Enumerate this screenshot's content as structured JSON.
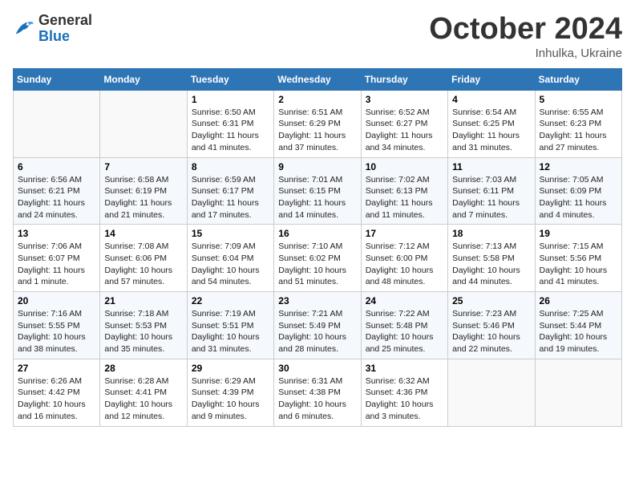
{
  "logo": {
    "general": "General",
    "blue": "Blue"
  },
  "header": {
    "month": "October 2024",
    "location": "Inhulka, Ukraine"
  },
  "weekdays": [
    "Sunday",
    "Monday",
    "Tuesday",
    "Wednesday",
    "Thursday",
    "Friday",
    "Saturday"
  ],
  "weeks": [
    [
      {
        "day": "",
        "content": ""
      },
      {
        "day": "",
        "content": ""
      },
      {
        "day": "1",
        "content": "Sunrise: 6:50 AM\nSunset: 6:31 PM\nDaylight: 11 hours and 41 minutes."
      },
      {
        "day": "2",
        "content": "Sunrise: 6:51 AM\nSunset: 6:29 PM\nDaylight: 11 hours and 37 minutes."
      },
      {
        "day": "3",
        "content": "Sunrise: 6:52 AM\nSunset: 6:27 PM\nDaylight: 11 hours and 34 minutes."
      },
      {
        "day": "4",
        "content": "Sunrise: 6:54 AM\nSunset: 6:25 PM\nDaylight: 11 hours and 31 minutes."
      },
      {
        "day": "5",
        "content": "Sunrise: 6:55 AM\nSunset: 6:23 PM\nDaylight: 11 hours and 27 minutes."
      }
    ],
    [
      {
        "day": "6",
        "content": "Sunrise: 6:56 AM\nSunset: 6:21 PM\nDaylight: 11 hours and 24 minutes."
      },
      {
        "day": "7",
        "content": "Sunrise: 6:58 AM\nSunset: 6:19 PM\nDaylight: 11 hours and 21 minutes."
      },
      {
        "day": "8",
        "content": "Sunrise: 6:59 AM\nSunset: 6:17 PM\nDaylight: 11 hours and 17 minutes."
      },
      {
        "day": "9",
        "content": "Sunrise: 7:01 AM\nSunset: 6:15 PM\nDaylight: 11 hours and 14 minutes."
      },
      {
        "day": "10",
        "content": "Sunrise: 7:02 AM\nSunset: 6:13 PM\nDaylight: 11 hours and 11 minutes."
      },
      {
        "day": "11",
        "content": "Sunrise: 7:03 AM\nSunset: 6:11 PM\nDaylight: 11 hours and 7 minutes."
      },
      {
        "day": "12",
        "content": "Sunrise: 7:05 AM\nSunset: 6:09 PM\nDaylight: 11 hours and 4 minutes."
      }
    ],
    [
      {
        "day": "13",
        "content": "Sunrise: 7:06 AM\nSunset: 6:07 PM\nDaylight: 11 hours and 1 minute."
      },
      {
        "day": "14",
        "content": "Sunrise: 7:08 AM\nSunset: 6:06 PM\nDaylight: 10 hours and 57 minutes."
      },
      {
        "day": "15",
        "content": "Sunrise: 7:09 AM\nSunset: 6:04 PM\nDaylight: 10 hours and 54 minutes."
      },
      {
        "day": "16",
        "content": "Sunrise: 7:10 AM\nSunset: 6:02 PM\nDaylight: 10 hours and 51 minutes."
      },
      {
        "day": "17",
        "content": "Sunrise: 7:12 AM\nSunset: 6:00 PM\nDaylight: 10 hours and 48 minutes."
      },
      {
        "day": "18",
        "content": "Sunrise: 7:13 AM\nSunset: 5:58 PM\nDaylight: 10 hours and 44 minutes."
      },
      {
        "day": "19",
        "content": "Sunrise: 7:15 AM\nSunset: 5:56 PM\nDaylight: 10 hours and 41 minutes."
      }
    ],
    [
      {
        "day": "20",
        "content": "Sunrise: 7:16 AM\nSunset: 5:55 PM\nDaylight: 10 hours and 38 minutes."
      },
      {
        "day": "21",
        "content": "Sunrise: 7:18 AM\nSunset: 5:53 PM\nDaylight: 10 hours and 35 minutes."
      },
      {
        "day": "22",
        "content": "Sunrise: 7:19 AM\nSunset: 5:51 PM\nDaylight: 10 hours and 31 minutes."
      },
      {
        "day": "23",
        "content": "Sunrise: 7:21 AM\nSunset: 5:49 PM\nDaylight: 10 hours and 28 minutes."
      },
      {
        "day": "24",
        "content": "Sunrise: 7:22 AM\nSunset: 5:48 PM\nDaylight: 10 hours and 25 minutes."
      },
      {
        "day": "25",
        "content": "Sunrise: 7:23 AM\nSunset: 5:46 PM\nDaylight: 10 hours and 22 minutes."
      },
      {
        "day": "26",
        "content": "Sunrise: 7:25 AM\nSunset: 5:44 PM\nDaylight: 10 hours and 19 minutes."
      }
    ],
    [
      {
        "day": "27",
        "content": "Sunrise: 6:26 AM\nSunset: 4:42 PM\nDaylight: 10 hours and 16 minutes."
      },
      {
        "day": "28",
        "content": "Sunrise: 6:28 AM\nSunset: 4:41 PM\nDaylight: 10 hours and 12 minutes."
      },
      {
        "day": "29",
        "content": "Sunrise: 6:29 AM\nSunset: 4:39 PM\nDaylight: 10 hours and 9 minutes."
      },
      {
        "day": "30",
        "content": "Sunrise: 6:31 AM\nSunset: 4:38 PM\nDaylight: 10 hours and 6 minutes."
      },
      {
        "day": "31",
        "content": "Sunrise: 6:32 AM\nSunset: 4:36 PM\nDaylight: 10 hours and 3 minutes."
      },
      {
        "day": "",
        "content": ""
      },
      {
        "day": "",
        "content": ""
      }
    ]
  ]
}
